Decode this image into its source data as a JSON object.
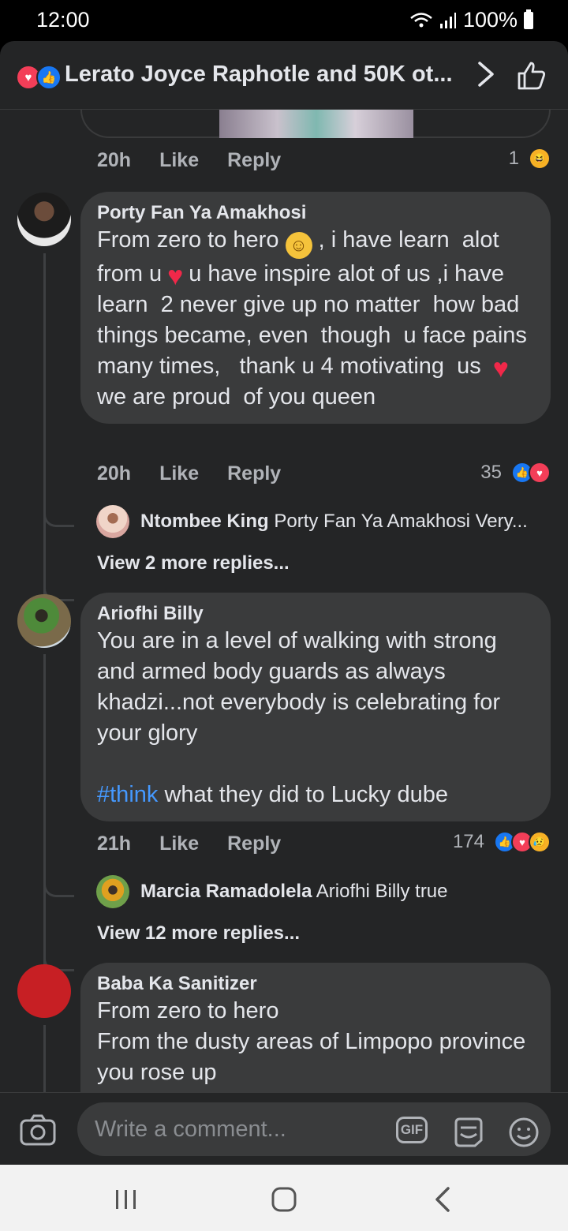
{
  "status_bar": {
    "time": "12:00",
    "battery": "100%"
  },
  "header": {
    "title": "Lerato Joyce Raphotle and 50K ot...",
    "icons": [
      "love-icon",
      "like-icon",
      "chevron-right-icon",
      "thumbs-up-icon"
    ]
  },
  "top_comment": {
    "time": "20h",
    "like": "Like",
    "reply": "Reply",
    "reaction_count": "1"
  },
  "comments": [
    {
      "author": "Porty Fan Ya Amakhosi",
      "text_parts": [
        "From zero to hero ",
        " , i have learn  alot from u",
        "u have inspire alot of us ,i have learn  2 never give up no matter  how bad things became, even  though  u face pains many times,   thank u 4 motivating  us ",
        "we are proud  of you queen"
      ],
      "time": "20h",
      "like": "Like",
      "reply": "Reply",
      "reaction_count": "35",
      "replies": {
        "author": "Ntombee King",
        "text": "Porty Fan Ya Amakhosi  Very...",
        "view_more": "View 2 more replies..."
      }
    },
    {
      "author": "Ariofhi Billy",
      "text": "You are in a level of walking with strong and armed body guards as always khadzi...not everybody is celebrating for your glory",
      "hashtag": "#think",
      "text_after": " what they did to Lucky dube",
      "time": "21h",
      "like": "Like",
      "reply": "Reply",
      "reaction_count": "174",
      "replies": {
        "author": "Marcia Ramadolela",
        "text": "Ariofhi Billy  true",
        "view_more": "View 12 more replies..."
      }
    },
    {
      "author": "Baba Ka Sanitizer",
      "text": "From zero to hero\nFrom the dusty areas of Limpopo province you rose up"
    }
  ],
  "composer": {
    "placeholder": "Write a comment...",
    "gif_label": "GIF"
  },
  "colors": {
    "background": "#242526",
    "bubble": "#3a3b3c",
    "link": "#4599ff",
    "love": "#f33e58",
    "like": "#1877f2"
  }
}
